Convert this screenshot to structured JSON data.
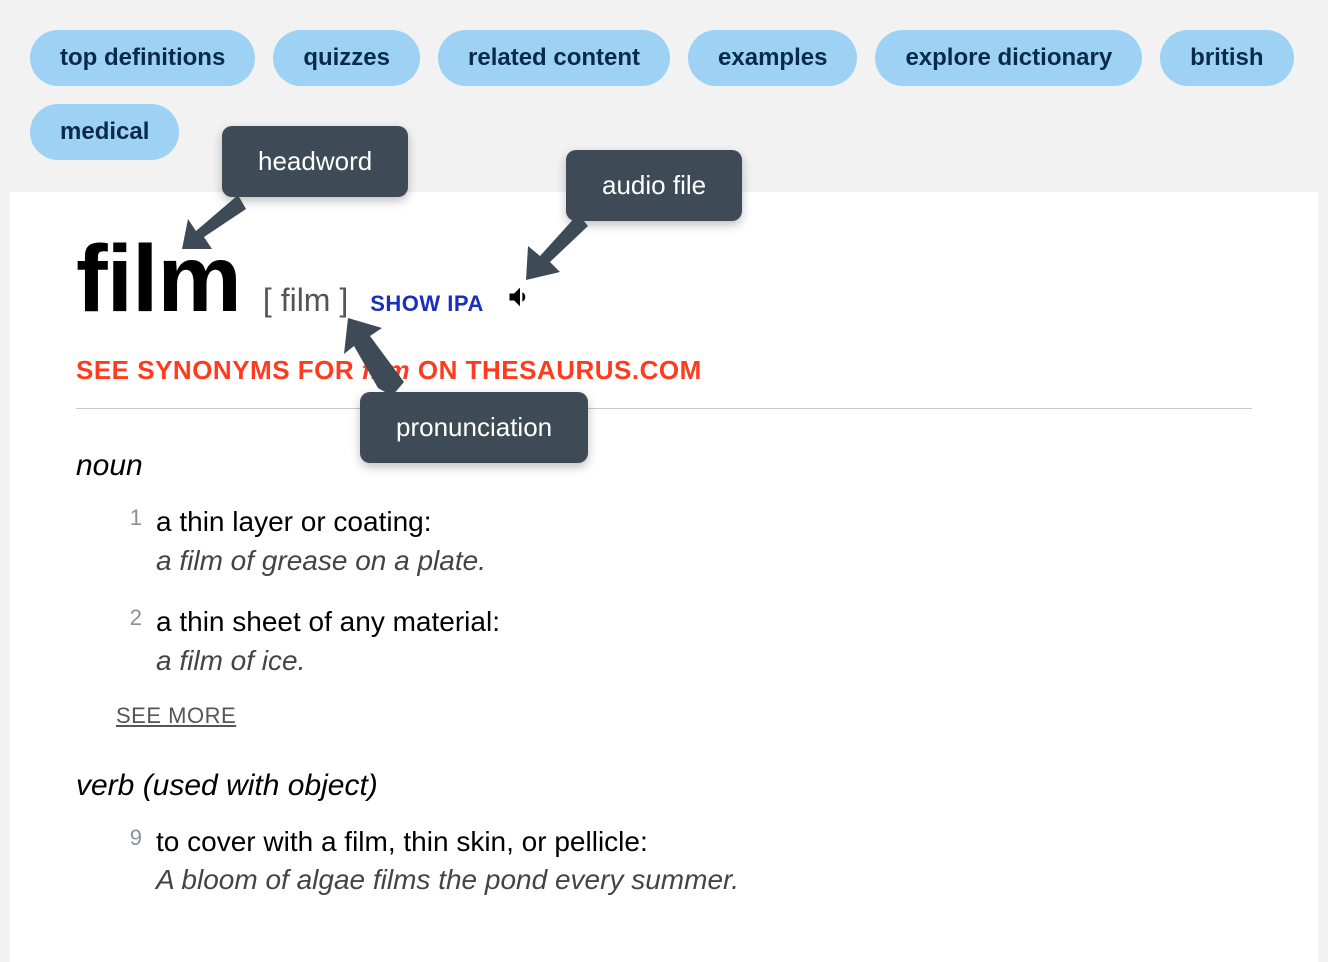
{
  "nav": {
    "items": [
      "top definitions",
      "quizzes",
      "related content",
      "examples",
      "explore dictionary",
      "british",
      "medical"
    ]
  },
  "entry": {
    "headword": "film",
    "pronunciation": "[ film ]",
    "show_ipa_label": "SHOW IPA",
    "synonyms_prefix": "SEE SYNONYMS FOR ",
    "synonyms_word": "film",
    "synonyms_suffix": " ON THESAURUS.COM",
    "see_more_label": "SEE MORE",
    "parts": {
      "noun": {
        "label": "noun",
        "senses": [
          {
            "num": "1",
            "def": "a thin layer or coating:",
            "example": "a film of grease on a plate."
          },
          {
            "num": "2",
            "def": "a thin sheet of any material:",
            "example": "a film of ice."
          }
        ]
      },
      "verb": {
        "label": "verb (used with object)",
        "senses": [
          {
            "num": "9",
            "def": "to cover with a film, thin skin, or pellicle:",
            "example": "A bloom of algae films the pond every summer."
          }
        ]
      }
    }
  },
  "labels": {
    "headword": "headword",
    "audio": "audio file",
    "pronunciation": "pronunciation"
  }
}
